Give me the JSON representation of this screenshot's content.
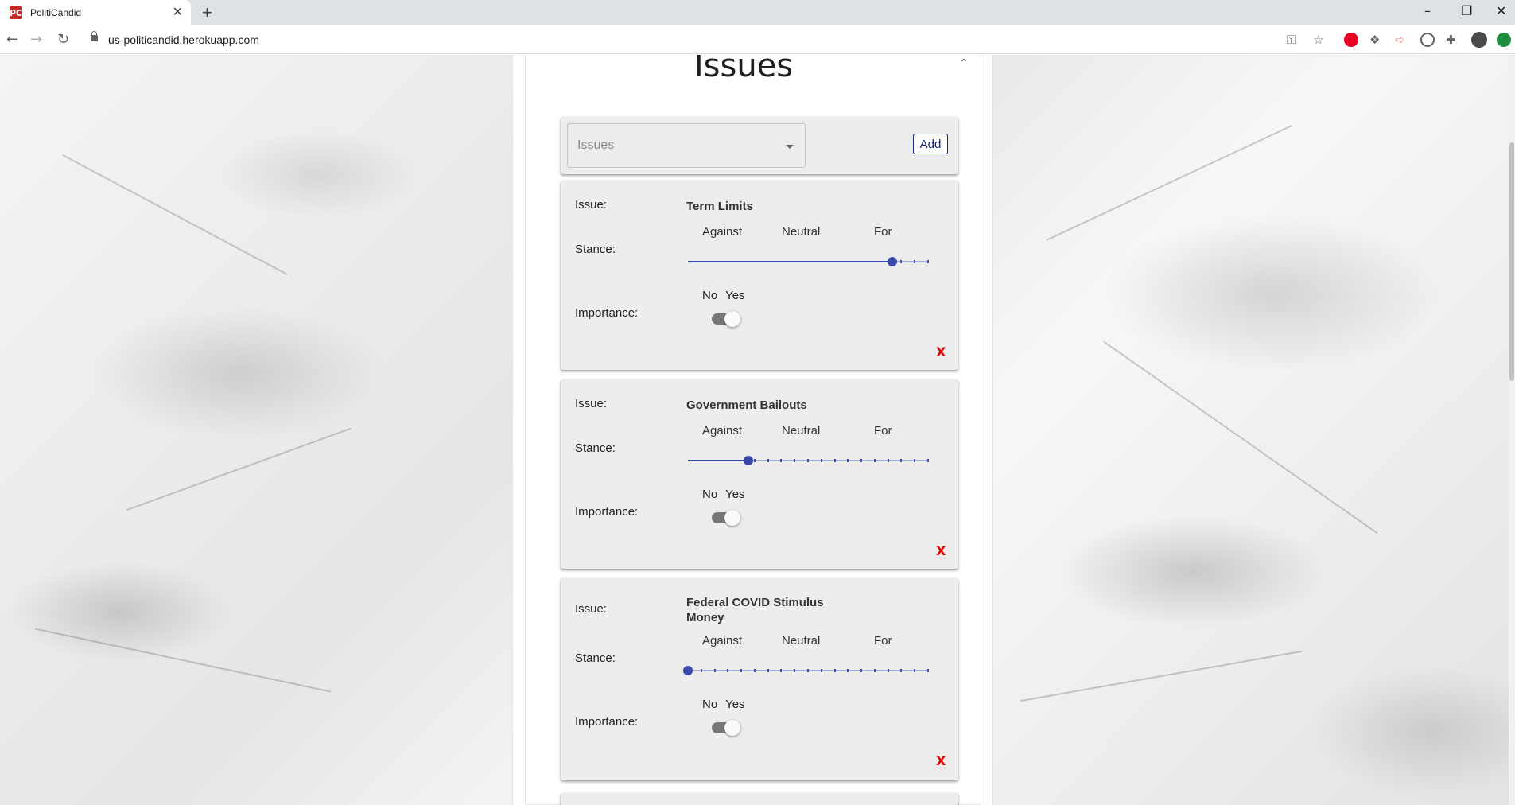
{
  "browser": {
    "tab_title": "PolitiCandid",
    "favicon_text": "PC",
    "url": "us-politicandid.herokuapp.com"
  },
  "section": {
    "title": "Issues"
  },
  "add_panel": {
    "select_placeholder": "Issues",
    "add_label": "Add"
  },
  "labels": {
    "issue": "Issue:",
    "stance": "Stance:",
    "importance": "Importance:",
    "against": "Against",
    "neutral": "Neutral",
    "for": "For",
    "no_yes": "No Yes",
    "remove": "X"
  },
  "issues": [
    {
      "name": "Term Limits",
      "stance_fraction": 0.85,
      "importance": false
    },
    {
      "name": "Government Bailouts",
      "stance_fraction": 0.25,
      "importance": false
    },
    {
      "name": "Federal COVID Stimulus Money",
      "stance_fraction": 0.0,
      "importance": false
    }
  ],
  "colors": {
    "accent": "#3949ab",
    "remove": "#e00000",
    "card": "#ededed"
  }
}
